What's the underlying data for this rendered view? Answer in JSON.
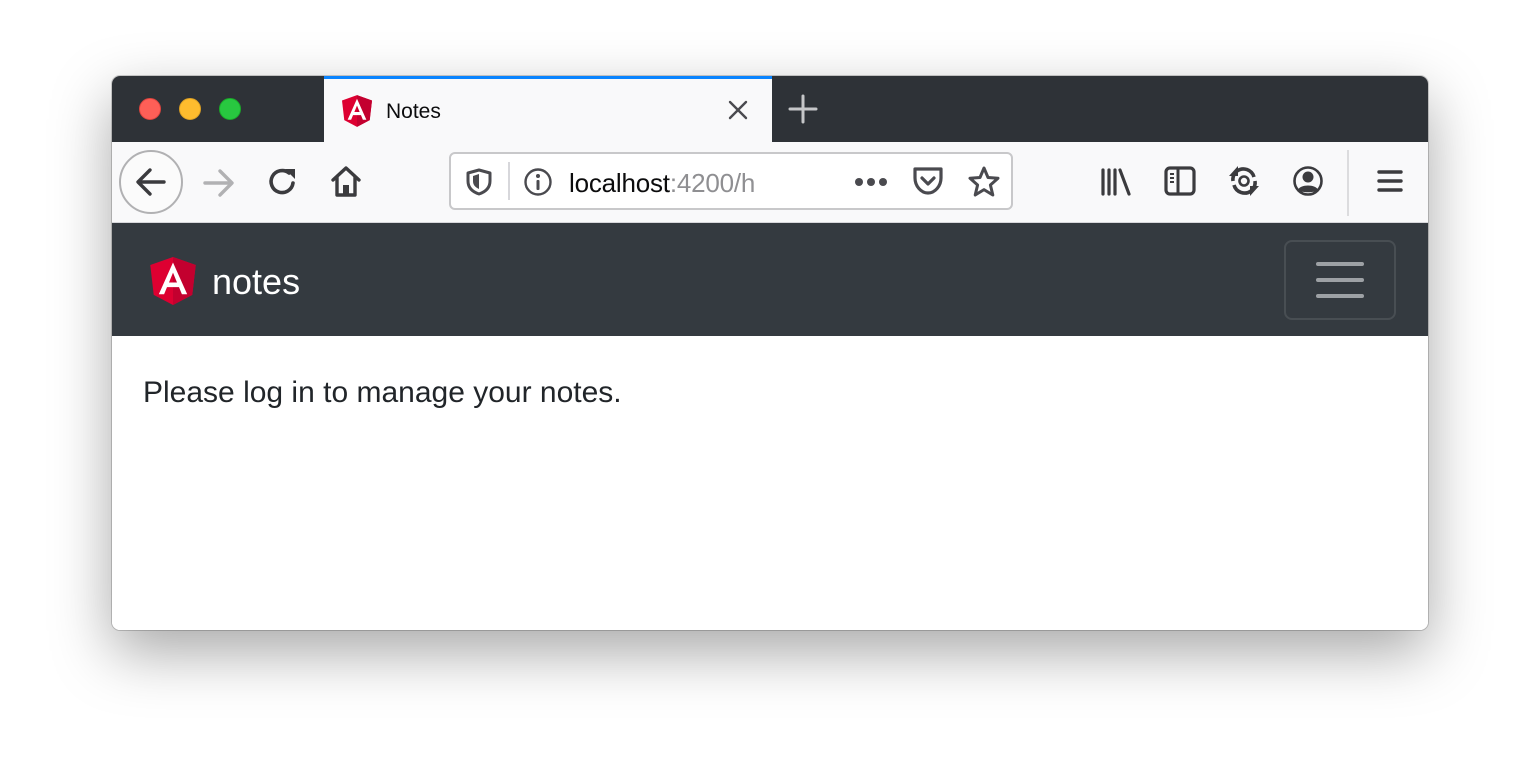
{
  "browser": {
    "tab": {
      "title": "Notes",
      "favicon": "angular-logo-icon"
    },
    "new_tab_icon": "plus-icon",
    "close_tab_icon": "close-icon",
    "toolbar": {
      "back_icon": "arrow-left-icon",
      "forward_icon": "arrow-right-icon",
      "reload_icon": "reload-icon",
      "home_icon": "home-icon",
      "library_icon": "library-icon",
      "sidebar_icon": "sidebar-icon",
      "sync_icon": "sync-icon",
      "account_icon": "account-icon",
      "menu_icon": "hamburger-menu-icon"
    },
    "urlbar": {
      "host": "localhost",
      "rest": ":4200/h",
      "shield_icon": "tracking-protection-shield-icon",
      "info_icon": "info-icon",
      "more_icon": "more-dots-icon",
      "pocket_icon": "pocket-icon",
      "bookmark_icon": "star-icon"
    },
    "colors": {
      "tab_accent": "#0a84ff",
      "tabbar_bg": "#2e3237",
      "toolbar_bg": "#f9f9fa"
    }
  },
  "app": {
    "navbar": {
      "brand": "notes",
      "brand_logo": "angular-logo-icon",
      "toggler_icon": "hamburger-menu-icon",
      "bg_color": "#343a40"
    },
    "main": {
      "message": "Please log in to manage your notes."
    }
  }
}
